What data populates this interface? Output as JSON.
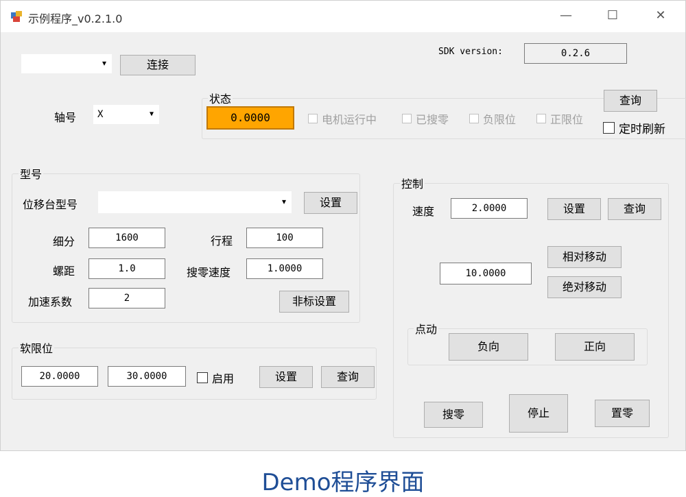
{
  "window": {
    "title": "示例程序_v0.2.1.0",
    "controls": {
      "minimize": "—",
      "maximize": "☐",
      "close": "✕"
    }
  },
  "connection": {
    "port_value": "",
    "connect_label": "连接"
  },
  "sdk": {
    "label": "SDK version:",
    "value": "0.2.6"
  },
  "axis": {
    "label": "轴号",
    "value": "X"
  },
  "status": {
    "title": "状态",
    "position": "0.0000",
    "position_color": "#FFA500",
    "flags": [
      "电机运行中",
      "已搜零",
      "负限位",
      "正限位"
    ],
    "query_label": "查询",
    "timer_label": "定时刷新"
  },
  "model": {
    "title": "型号",
    "stage_label": "位移台型号",
    "stage_value": "",
    "set_label": "设置",
    "subdivision_label": "细分",
    "subdivision_value": "1600",
    "stroke_label": "行程",
    "stroke_value": "100",
    "pitch_label": "螺距",
    "pitch_value": "1.0",
    "home_speed_label": "搜零速度",
    "home_speed_value": "1.0000",
    "accel_label": "加速系数",
    "accel_value": "2",
    "nonstandard_label": "非标设置"
  },
  "soft_limit": {
    "title": "软限位",
    "min_value": "20.0000",
    "max_value": "30.0000",
    "enable_label": "启用",
    "set_label": "设置",
    "query_label": "查询"
  },
  "control": {
    "title": "控制",
    "speed_label": "速度",
    "speed_value": "2.0000",
    "set_label": "设置",
    "query_label": "查询",
    "move_value": "10.0000",
    "rel_move_label": "相对移动",
    "abs_move_label": "绝对移动",
    "jog_title": "点动",
    "neg_label": "负向",
    "pos_label": "正向",
    "home_label": "搜零",
    "stop_label": "停止",
    "zero_label": "置零"
  },
  "caption": "Demo程序界面"
}
